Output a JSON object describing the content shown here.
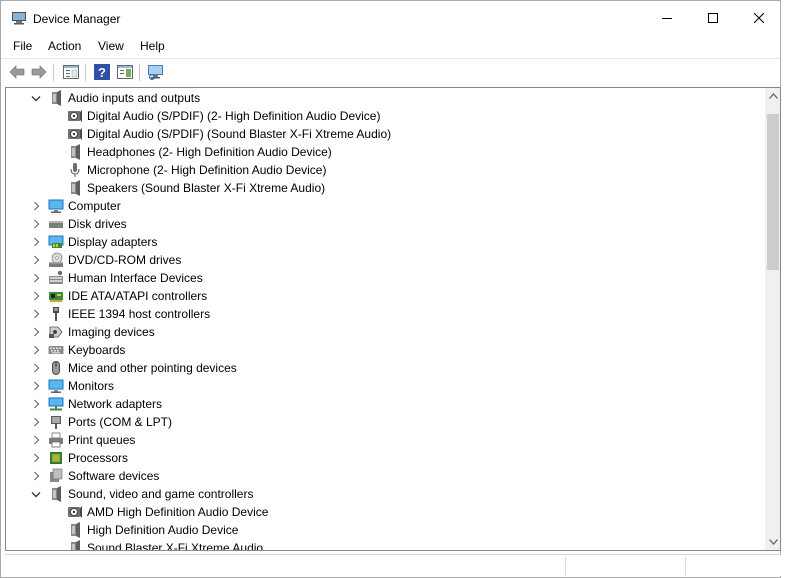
{
  "window": {
    "title": "Device Manager"
  },
  "menu": {
    "items": [
      "File",
      "Action",
      "View",
      "Help"
    ]
  },
  "toolbar": {
    "buttons": [
      "back-icon",
      "forward-icon",
      "properties-pane-icon",
      "help-icon",
      "show-hide-icon",
      "scan-hardware-icon"
    ]
  },
  "tree": {
    "rows": [
      {
        "level": 0,
        "expanded": true,
        "label": "Audio inputs and outputs",
        "icon": "speaker-icon"
      },
      {
        "level": 1,
        "label": "Digital Audio (S/PDIF) (2- High Definition Audio Device)",
        "icon": "digital-audio-icon"
      },
      {
        "level": 1,
        "label": "Digital Audio (S/PDIF) (Sound Blaster X-Fi Xtreme Audio)",
        "icon": "digital-audio-icon"
      },
      {
        "level": 1,
        "label": "Headphones (2- High Definition Audio Device)",
        "icon": "speaker-icon"
      },
      {
        "level": 1,
        "label": "Microphone (2- High Definition Audio Device)",
        "icon": "microphone-icon"
      },
      {
        "level": 1,
        "label": "Speakers (Sound Blaster X-Fi Xtreme Audio)",
        "icon": "speaker-icon"
      },
      {
        "level": 0,
        "expanded": false,
        "label": "Computer",
        "icon": "computer-icon"
      },
      {
        "level": 0,
        "expanded": false,
        "label": "Disk drives",
        "icon": "disk-drive-icon"
      },
      {
        "level": 0,
        "expanded": false,
        "label": "Display adapters",
        "icon": "display-adapter-icon"
      },
      {
        "level": 0,
        "expanded": false,
        "label": "DVD/CD-ROM drives",
        "icon": "dvd-drive-icon"
      },
      {
        "level": 0,
        "expanded": false,
        "label": "Human Interface Devices",
        "icon": "hid-icon"
      },
      {
        "level": 0,
        "expanded": false,
        "label": "IDE ATA/ATAPI controllers",
        "icon": "ide-controller-icon"
      },
      {
        "level": 0,
        "expanded": false,
        "label": "IEEE 1394 host controllers",
        "icon": "ieee1394-icon"
      },
      {
        "level": 0,
        "expanded": false,
        "label": "Imaging devices",
        "icon": "camera-icon"
      },
      {
        "level": 0,
        "expanded": false,
        "label": "Keyboards",
        "icon": "keyboard-icon"
      },
      {
        "level": 0,
        "expanded": false,
        "label": "Mice and other pointing devices",
        "icon": "mouse-icon"
      },
      {
        "level": 0,
        "expanded": false,
        "label": "Monitors",
        "icon": "monitor-icon"
      },
      {
        "level": 0,
        "expanded": false,
        "label": "Network adapters",
        "icon": "network-adapter-icon"
      },
      {
        "level": 0,
        "expanded": false,
        "label": "Ports (COM & LPT)",
        "icon": "port-icon"
      },
      {
        "level": 0,
        "expanded": false,
        "label": "Print queues",
        "icon": "printer-icon"
      },
      {
        "level": 0,
        "expanded": false,
        "label": "Processors",
        "icon": "processor-icon"
      },
      {
        "level": 0,
        "expanded": false,
        "label": "Software devices",
        "icon": "software-device-icon"
      },
      {
        "level": 0,
        "expanded": true,
        "label": "Sound, video and game controllers",
        "icon": "speaker-icon"
      },
      {
        "level": 1,
        "label": "AMD High Definition Audio Device",
        "icon": "digital-audio-icon"
      },
      {
        "level": 1,
        "label": "High Definition Audio Device",
        "icon": "speaker-icon"
      },
      {
        "level": 1,
        "label": "Sound Blaster X-Fi Xtreme Audio",
        "icon": "speaker-icon"
      }
    ]
  },
  "colors": {
    "border": "#828790",
    "scroll_thumb": "#cdcdcd",
    "icon_blue": "#1e73be",
    "icon_gray": "#6d6d6d"
  }
}
